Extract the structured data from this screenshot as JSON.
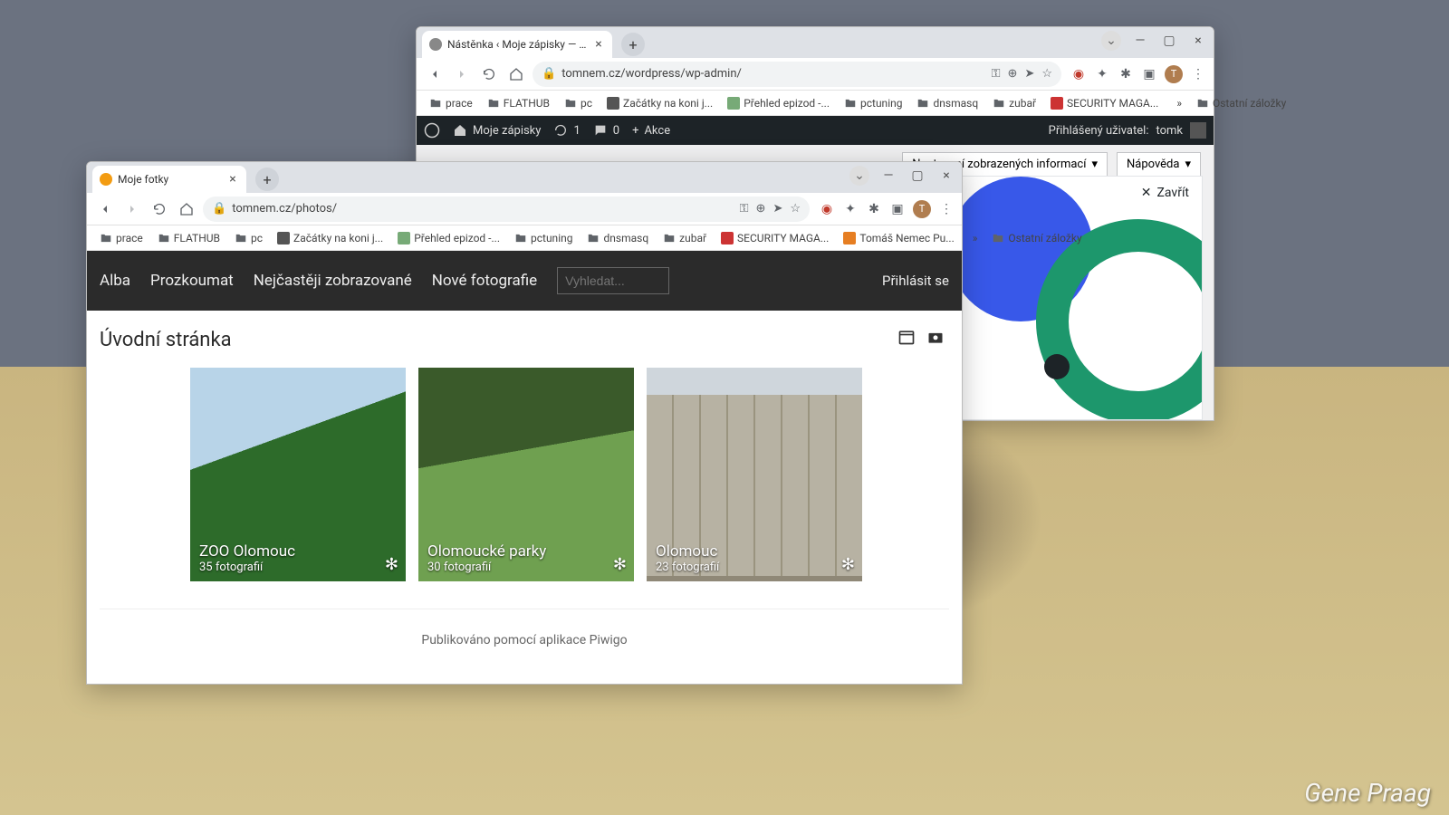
{
  "desktop": {
    "watermark": "Gene Praag"
  },
  "back_window": {
    "tab_title": "Nástěnka ‹ Moje zápisky — W",
    "url": "tomnem.cz/wordpress/wp-admin/",
    "bookmarks": [
      "prace",
      "FLATHUB",
      "pc",
      "Začátky na koni j...",
      "Přehled epizod -...",
      "pctuning",
      "dnsmasq",
      "zubař",
      "SECURITY MAGA..."
    ],
    "bookmarks_overflow": "»",
    "bookmarks_other": "Ostatní záložky",
    "wp_bar": {
      "site": "Moje zápisky",
      "updates": "1",
      "comments": "0",
      "new": "Akce",
      "login_prefix": "Přihlášený uživatel:",
      "login_user": "tomk"
    },
    "wp_body": {
      "screen_options": "Nastavení zobrazených informací",
      "help": "Nápověda",
      "close": "Zavřít"
    }
  },
  "front_window": {
    "tab_title": "Moje fotky",
    "url": "tomnem.cz/photos/",
    "bookmarks": [
      "prace",
      "FLATHUB",
      "pc",
      "Začátky na koni j...",
      "Přehled epizod -...",
      "pctuning",
      "dnsmasq",
      "zubař",
      "SECURITY MAGA...",
      "Tomáš Nemec Pu..."
    ],
    "bookmarks_overflow": "»",
    "bookmarks_other": "Ostatní záložky",
    "nav": {
      "albums": "Alba",
      "explore": "Prozkoumat",
      "most_viewed": "Nejčastěji zobrazované",
      "new_photos": "Nové fotografie",
      "search_placeholder": "Vyhledat...",
      "login": "Přihlásit se"
    },
    "page_heading": "Úvodní stránka",
    "albums": [
      {
        "title": "ZOO Olomouc",
        "count": "35 fotografií"
      },
      {
        "title": "Olomoucké parky",
        "count": "30 fotografií"
      },
      {
        "title": "Olomouc",
        "count": "23 fotografií"
      }
    ],
    "footer": "Publikováno pomocí aplikace Piwigo"
  },
  "avatar_initial": "T"
}
